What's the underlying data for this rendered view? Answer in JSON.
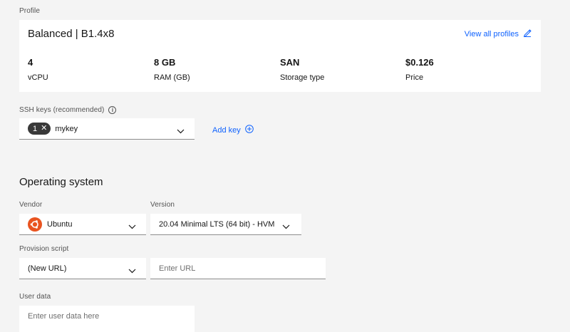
{
  "profile": {
    "section_label": "Profile",
    "title": "Balanced | B1.4x8",
    "view_all_label": "View all profiles",
    "stats": [
      {
        "value": "4",
        "label": "vCPU"
      },
      {
        "value": "8 GB",
        "label": "RAM (GB)"
      },
      {
        "value": "SAN",
        "label": "Storage type"
      },
      {
        "value": "$0.126",
        "label": "Price"
      }
    ]
  },
  "ssh": {
    "label": "SSH keys (recommended)",
    "tag_count": "1",
    "selected_key": "mykey",
    "add_key_label": "Add key"
  },
  "os": {
    "heading": "Operating system",
    "vendor_label": "Vendor",
    "vendor_value": "Ubuntu",
    "version_label": "Version",
    "version_value": "20.04 Minimal LTS (64 bit) - HVM",
    "provision_label": "Provision script",
    "provision_value": "(New URL)",
    "url_placeholder": "Enter URL",
    "user_data_label": "User data",
    "user_data_placeholder": "Enter user data here"
  },
  "colors": {
    "accent": "#0f62fe",
    "ubuntu": "#e95420",
    "tag_bg": "#393939"
  }
}
